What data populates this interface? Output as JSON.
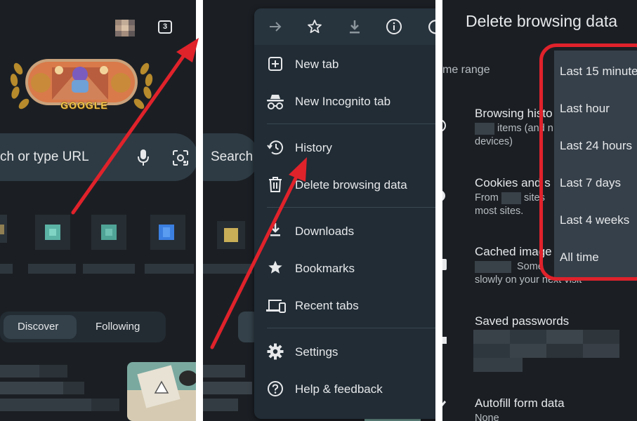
{
  "colors": {
    "background": "#1b1f24",
    "menu": "#212c35",
    "dropdown": "#36404a",
    "annotation_red": "#e0222b",
    "text": "#e6e8ea"
  },
  "panel1": {
    "tab_count": "3",
    "doodle_text": "GOOGLE",
    "omnibox_text": "ch or type URL",
    "feed_tabs": [
      "Discover",
      "Following"
    ]
  },
  "panel2": {
    "omnibox_text": "Search",
    "toolbar_icons": [
      "forward-icon",
      "star-icon",
      "download-icon",
      "info-icon",
      "refresh-icon"
    ],
    "menu_items": [
      {
        "label": "New tab",
        "icon": "new-tab-icon"
      },
      {
        "label": "New Incognito tab",
        "icon": "incognito-icon"
      },
      {
        "label": "History",
        "icon": "history-icon"
      },
      {
        "label": "Delete browsing data",
        "icon": "trash-icon"
      },
      {
        "label": "Downloads",
        "icon": "downloads-icon"
      },
      {
        "label": "Bookmarks",
        "icon": "bookmarks-star-icon"
      },
      {
        "label": "Recent tabs",
        "icon": "devices-icon"
      },
      {
        "label": "Settings",
        "icon": "settings-gear-icon"
      },
      {
        "label": "Help & feedback",
        "icon": "help-icon"
      }
    ]
  },
  "panel3": {
    "title": "Delete browsing data",
    "time_range_label": "me range",
    "items": [
      {
        "title": "Browsing histo",
        "sub1": "items (and n",
        "sub2": "devices)"
      },
      {
        "title": "Cookies and s",
        "sub1_prefix": "From",
        "sub1": "sites",
        "sub2": "most sites."
      },
      {
        "title": "Cached image",
        "sub1": "Some",
        "sub2": "slowly on your next visit"
      },
      {
        "title": "Saved passwords"
      },
      {
        "title": "Autofill form data",
        "sub1": "None"
      }
    ],
    "dropdown_options": [
      "Last 15 minute",
      "Last hour",
      "Last 24 hours",
      "Last 7 days",
      "Last 4 weeks",
      "All time"
    ]
  }
}
